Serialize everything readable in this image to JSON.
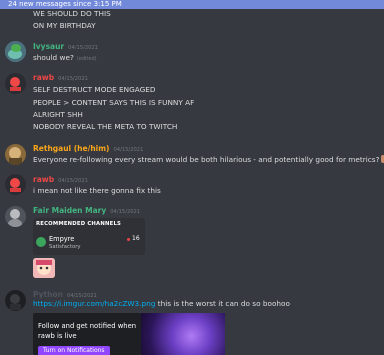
{
  "banner": {
    "text": "24 new messages since 3:15 PM"
  },
  "messages": [
    {
      "lines": [
        "WE SHOULD DO THIS",
        "ON MY BIRTHDAY"
      ]
    },
    {
      "author": "Ivysaur",
      "author_color": "#43b581",
      "time": "04/15/2021",
      "text": "should we?",
      "edited": "(edited)"
    },
    {
      "author": "rawb",
      "author_color": "#f04747",
      "time": "04/15/2021",
      "lines": [
        "SELF DESTRUCT MODE ENGAGED",
        "PEOPLE > CONTENT SAYS THIS IS FUNNY AF",
        "ALRIGHT SHH",
        "NOBODY REVEAL THE META TO TWITCH"
      ]
    },
    {
      "author": "Rethgaul (he/him)",
      "author_color": "#faa61a",
      "time": "04/15/2021",
      "text": "Everyone re-following every stream would be both hilarious - and potentially good for metrics?"
    },
    {
      "author": "rawb",
      "author_color": "#f04747",
      "time": "04/15/2021",
      "text": "i mean not like there gonna fix this"
    },
    {
      "author": "Fair Maiden Mary",
      "author_color": "#43b581",
      "time": "04/15/2021",
      "embed": {
        "title": "RECOMMENDED CHANNELS",
        "channel": "Empyre",
        "game": "Satisfactory",
        "viewers": "16"
      }
    },
    {
      "author": "Python",
      "author_color": "#4f545c",
      "time": "04/15/2021",
      "link": "https://i.imgur.com/ha2cZW3.png",
      "text": "this is the worst it can do so boohoo",
      "card": {
        "text": "Follow and get notified when rawb is live",
        "button": "Turn on Notifications"
      }
    }
  ],
  "colors": {
    "background": "#36393f",
    "banner": "#7289da",
    "link": "#00b0f4",
    "twitch_purple": "#9147ff"
  }
}
